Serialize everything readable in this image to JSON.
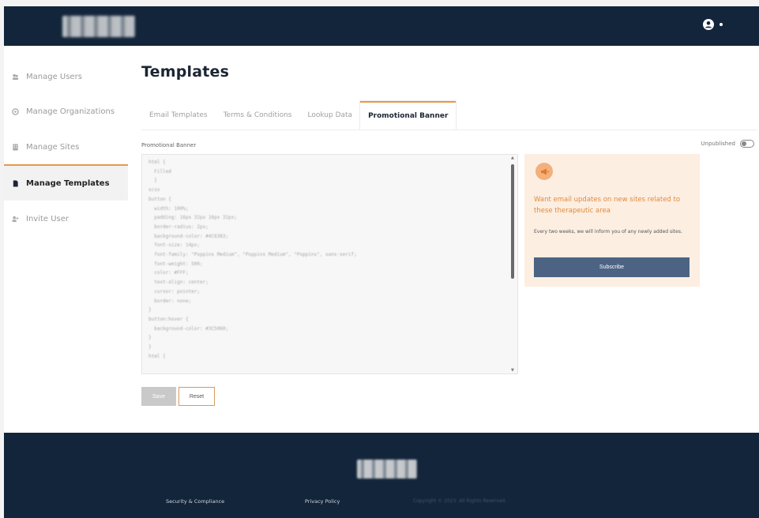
{
  "colors": {
    "navy": "#13253a",
    "accent": "#e59a4d",
    "button_blue": "#4c6383",
    "preview_bg": "#fdeee2"
  },
  "header": {
    "logo_icon": "brand-logo",
    "user_icon": "user-circle-icon"
  },
  "sidebar": {
    "items": [
      {
        "label": "Manage Users",
        "icon": "users-icon",
        "active": false
      },
      {
        "label": "Manage Organizations",
        "icon": "organization-icon",
        "active": false
      },
      {
        "label": "Manage Sites",
        "icon": "building-icon",
        "active": false
      },
      {
        "label": "Manage Templates",
        "icon": "document-icon",
        "active": true
      },
      {
        "label": "Invite User",
        "icon": "user-plus-icon",
        "active": false
      }
    ]
  },
  "main": {
    "title": "Templates",
    "tabs": [
      {
        "label": "Email Templates"
      },
      {
        "label": "Terms & Conditions"
      },
      {
        "label": "Lookup Data"
      },
      {
        "label": "Promotional Banner",
        "active": true
      }
    ],
    "field_label": "Promotional Banner",
    "toggle_label": "Unpublished",
    "editor_code": "html {\n  Filled\n  }\nscss\nbutton {\n  width: 100%;\n  padding: 16px 32px 16px 32px;\n  border-radius: 2px;\n  background-color: #4C6383;\n  font-size: 14px;\n  font-family: \"Poppins Medium\", \"Poppins Medium\", \"Poppins\", sans-serif;\n  font-weight: 500;\n  color: #FFF;\n  text-align: center;\n  cursor: pointer;\n  border: none;\n}\nbutton:hover {\n  background-color: #3C5060;\n}\n}\nhtml {",
    "save_label": "Save",
    "reset_label": "Reset"
  },
  "preview": {
    "icon": "megaphone-icon",
    "heading": "Want email updates on new sites related to these therapeutic area",
    "text": "Every two weeks, we will inform you of any newly added sites.",
    "button_label": "Subscribe"
  },
  "footer": {
    "links": [
      "Security & Compliance",
      "Privacy Policy"
    ],
    "copyright": "Copyright © 2023. All Rights Reserved."
  }
}
